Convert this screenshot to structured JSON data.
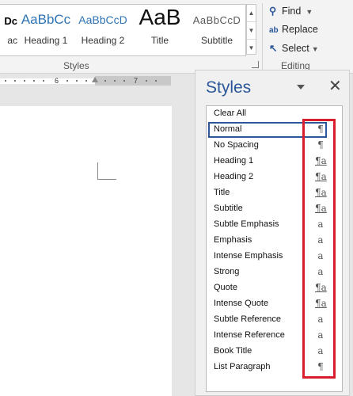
{
  "ribbon": {
    "gallery": [
      {
        "sample": "Dc",
        "caption": "ac"
      },
      {
        "sample": "AaBbCc",
        "caption": "Heading 1"
      },
      {
        "sample": "AaBbCcD",
        "caption": "Heading 2"
      },
      {
        "sample": "AaB",
        "caption": "Title"
      },
      {
        "sample": "AaBbCcD",
        "caption": "Subtitle"
      }
    ],
    "styles_group_label": "Styles",
    "editing": {
      "find_label": "Find",
      "replace_label": "Replace",
      "select_label": "Select",
      "group_label": "Editing"
    }
  },
  "ruler": {
    "marks": [
      "6",
      "7"
    ]
  },
  "styles_pane": {
    "title": "Styles",
    "close_glyph": "✕",
    "items": [
      {
        "label": "Clear All",
        "glyph": "",
        "glyph_type": "none"
      },
      {
        "label": "Normal",
        "glyph": "¶",
        "glyph_type": "paragraph",
        "selected": true
      },
      {
        "label": "No Spacing",
        "glyph": "¶",
        "glyph_type": "paragraph"
      },
      {
        "label": "Heading 1",
        "glyph": "¶a",
        "glyph_type": "linked"
      },
      {
        "label": "Heading 2",
        "glyph": "¶a",
        "glyph_type": "linked"
      },
      {
        "label": "Title",
        "glyph": "¶a",
        "glyph_type": "linked"
      },
      {
        "label": "Subtitle",
        "glyph": "¶a",
        "glyph_type": "linked"
      },
      {
        "label": "Subtle Emphasis",
        "glyph": "a",
        "glyph_type": "character"
      },
      {
        "label": "Emphasis",
        "glyph": "a",
        "glyph_type": "character"
      },
      {
        "label": "Intense Emphasis",
        "glyph": "a",
        "glyph_type": "character"
      },
      {
        "label": "Strong",
        "glyph": "a",
        "glyph_type": "character"
      },
      {
        "label": "Quote",
        "glyph": "¶a",
        "glyph_type": "linked"
      },
      {
        "label": "Intense Quote",
        "glyph": "¶a",
        "glyph_type": "linked"
      },
      {
        "label": "Subtle Reference",
        "glyph": "a",
        "glyph_type": "character"
      },
      {
        "label": "Intense Reference",
        "glyph": "a",
        "glyph_type": "character"
      },
      {
        "label": "Book Title",
        "glyph": "a",
        "glyph_type": "character"
      },
      {
        "label": "List Paragraph",
        "glyph": "¶",
        "glyph_type": "paragraph"
      }
    ]
  },
  "colors": {
    "accent": "#2b579a",
    "highlight": "#d81e2c"
  }
}
